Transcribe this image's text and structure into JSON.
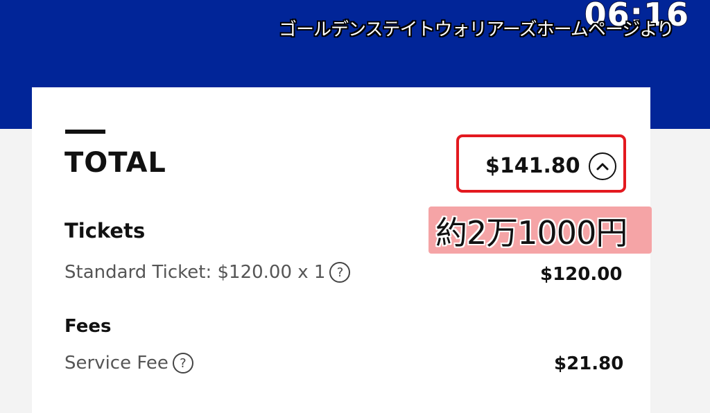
{
  "overlay": {
    "clock": "06:16",
    "caption": "ゴールデンステイトウォリアーズホームページより",
    "yen_note": "約2万1000円"
  },
  "summary": {
    "total_label": "TOTAL",
    "total_amount": "$141.80",
    "toggle_icon": "chevron-up-icon"
  },
  "tickets": {
    "heading": "Tickets",
    "items": [
      {
        "label": "Standard Ticket: $120.00 x 1",
        "amount": "$120.00",
        "help": "?"
      }
    ]
  },
  "fees": {
    "heading": "Fees",
    "items": [
      {
        "label": "Service Fee",
        "amount": "$21.80",
        "help": "?"
      }
    ]
  },
  "colors": {
    "header_blue": "#012598",
    "highlight_red": "#e3191f",
    "note_pink": "#f5a4a6"
  }
}
